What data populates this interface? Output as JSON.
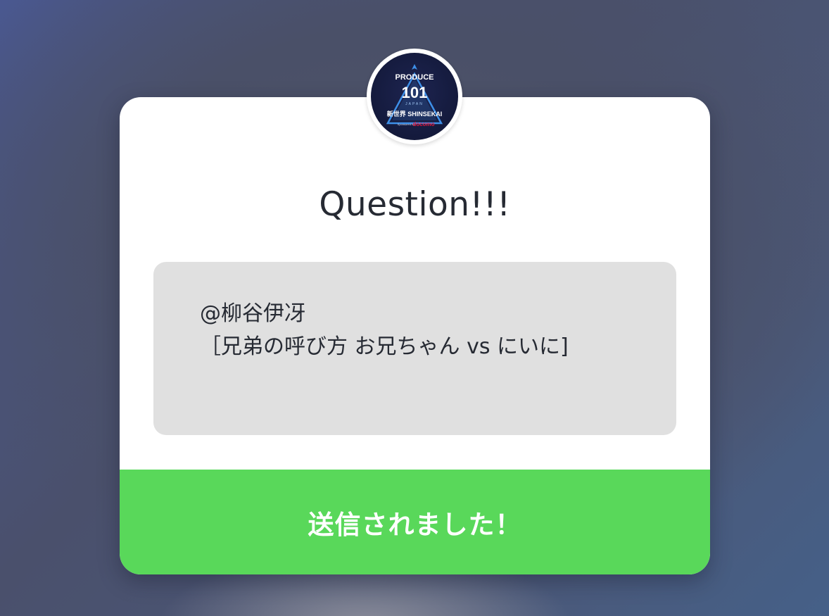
{
  "avatar": {
    "logo_text_top": "PRODUCE",
    "logo_number": "101",
    "logo_sub": "JAPAN",
    "logo_series": "新世界 SHINSEKAI",
    "logo_sponsor_prefix": "Sponsored by",
    "logo_sponsor": "docomo"
  },
  "card": {
    "title": "Question!!!",
    "question_line1": "@柳谷伊冴",
    "question_line2": "［兄弟の呼び方 お兄ちゃん vs にいに]",
    "status": "送信されました！"
  },
  "colors": {
    "card_background": "#ffffff",
    "question_background": "#e0e0e0",
    "status_green": "#59d85a",
    "text_dark": "#262a33",
    "logo_navy": "#141a3c",
    "logo_blue": "#3d8fe8",
    "sponsor_red": "#e3163a"
  }
}
